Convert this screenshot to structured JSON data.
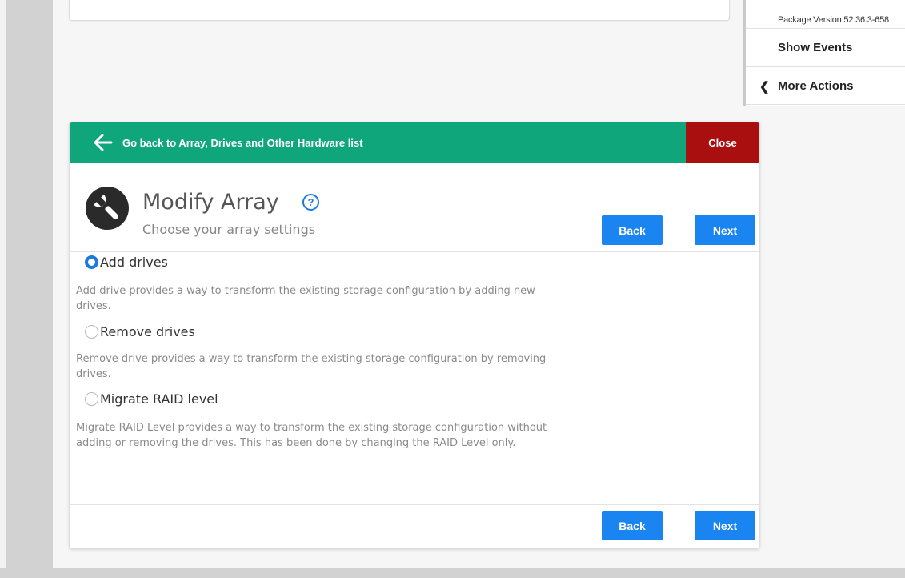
{
  "right_panel": {
    "package_version": "Package Version 52.36.3-658",
    "show_events": "Show Events",
    "more_actions": "More Actions",
    "more_actions_chevron": "❮"
  },
  "dialog": {
    "back_link": "Go back to Array, Drives and Other Hardware list",
    "close_label": "Close",
    "title": "Modify Array",
    "help": "?",
    "subtitle": "Choose your array settings",
    "back_label": "Back",
    "next_label": "Next",
    "options": [
      {
        "label": "Add drives",
        "checked": true,
        "description": "Add drive provides a way to transform the existing storage configuration by adding new drives."
      },
      {
        "label": "Remove drives",
        "checked": false,
        "description": "Remove drive provides a way to transform the existing storage configuration by removing drives."
      },
      {
        "label": "Migrate RAID level",
        "checked": false,
        "description": "Migrate RAID Level provides a way to transform the existing storage configuration without adding or removing the drives. This has been done by changing the RAID Level only."
      }
    ]
  },
  "colors": {
    "header_green": "#0ea67a",
    "close_red": "#a90f0f",
    "button_blue": "#1a84f0",
    "radio_blue": "#1a7ae0"
  },
  "icons": {
    "back": "arrow-left-icon",
    "wrench": "wrench-icon",
    "help": "help-circle-icon",
    "chevron": "chevron-left-icon"
  }
}
